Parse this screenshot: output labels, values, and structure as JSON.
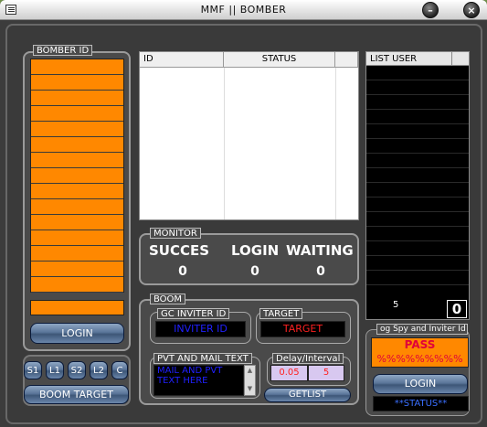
{
  "window": {
    "title": "MMF || BOMBER",
    "minimize_label": "–",
    "close_label": "×"
  },
  "bomber": {
    "legend": "BOMBER ID",
    "login_label": "LOGIN",
    "small_buttons": [
      "S1",
      "L1",
      "S2",
      "L2",
      "C"
    ],
    "boom_target_label": "BOOM TARGET"
  },
  "table": {
    "columns": [
      "ID",
      "STATUS",
      ""
    ],
    "rows": []
  },
  "list_user": {
    "legend": "LIST USER",
    "count_left": "5",
    "count_right": "0"
  },
  "monitor": {
    "legend": "MONITOR",
    "headers": [
      "SUCCES",
      "LOGIN",
      "WAITING"
    ],
    "values": [
      "0",
      "0",
      "0"
    ]
  },
  "boom": {
    "legend": "BOOM",
    "gc_inviter": {
      "legend": "GC INVITER ID",
      "value": "INVITER ID"
    },
    "target": {
      "legend": "TARGET",
      "value": "TARGET"
    },
    "pvt_mail": {
      "legend": "PVT AND MAIL TEXT",
      "value": "MAIL AND PVT\nTEXT HERE"
    },
    "delay": {
      "legend": "Delay/Interval",
      "delay_value": "0.05",
      "interval_value": "5"
    },
    "getlist_label": "GETLIST"
  },
  "spy": {
    "legend": "og Spy and Inviter Id",
    "pass_label": "PASS",
    "pass_mask": "%%%%%%%%%",
    "login_label": "LOGIN",
    "status_label": "**STATUS**"
  },
  "colors": {
    "accent_orange": "#ff8800",
    "window_bg": "#3a3a3a",
    "button_blue": "#5a7599",
    "inviter_text": "#2020ff",
    "target_text": "#ff2020"
  }
}
